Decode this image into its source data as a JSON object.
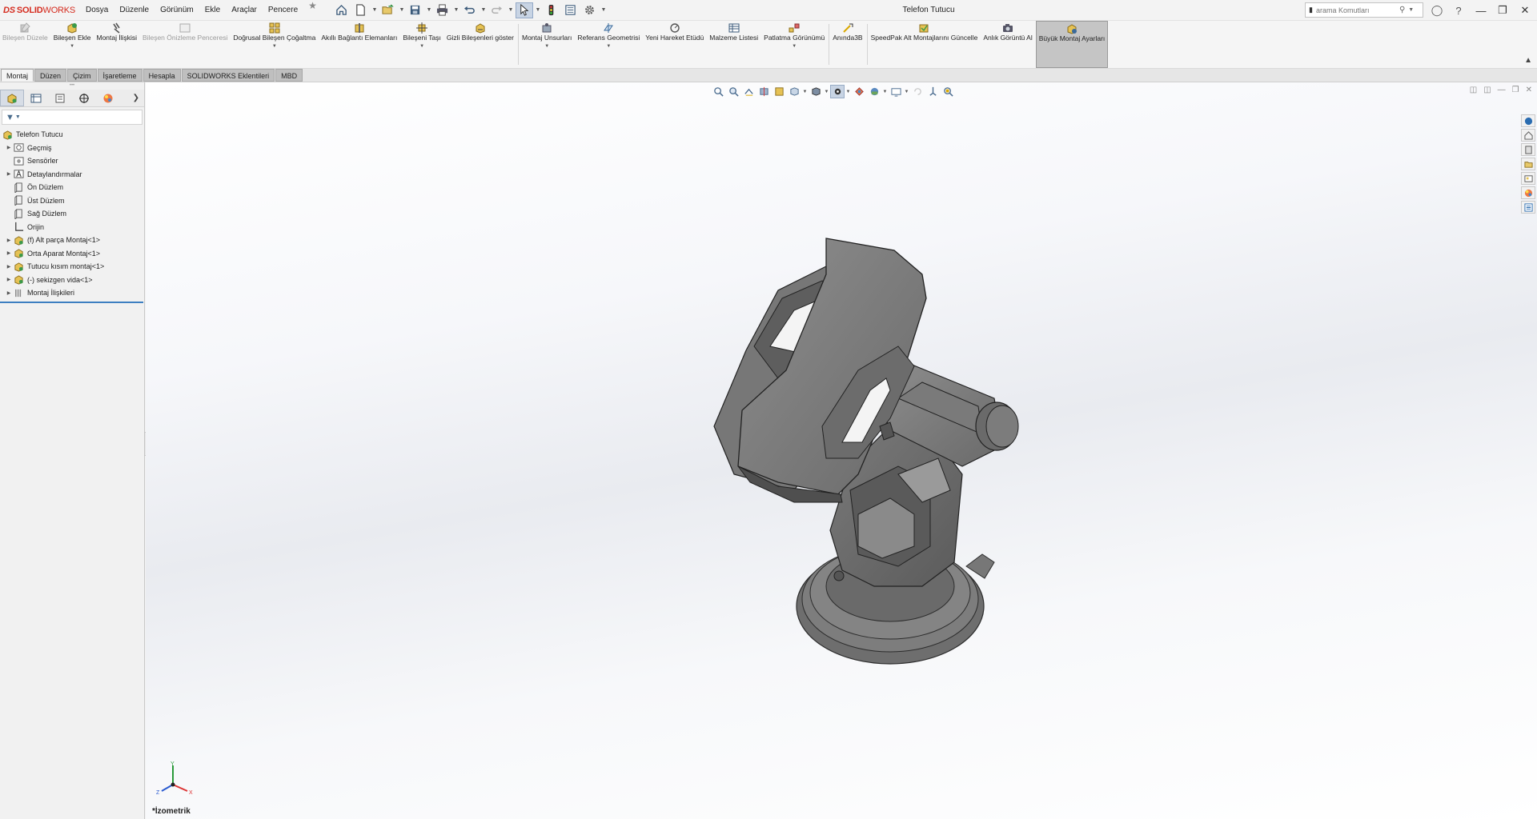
{
  "app": {
    "logo_prefix": "DS",
    "logo_solid": "SOLID",
    "logo_works": "WORKS",
    "document_title": "Telefon Tutucu"
  },
  "menu": [
    "Dosya",
    "Düzenle",
    "Görünüm",
    "Ekle",
    "Araçlar",
    "Pencere"
  ],
  "quick_access": [
    "home-icon",
    "new-document-icon",
    "open-icon",
    "save-icon",
    "print-icon",
    "undo-icon",
    "redo-icon",
    "select-arrow-icon",
    "traffic-light-icon",
    "file-properties-icon",
    "options-gear-icon"
  ],
  "search": {
    "placeholder": "arama Komutları"
  },
  "ribbon": [
    {
      "label": "Bileşen Düzele",
      "icon": "edit-component-icon",
      "disabled": true
    },
    {
      "label": "Bileşen Ekle",
      "icon": "insert-component-icon"
    },
    {
      "label": "Montaj İlişkisi",
      "icon": "mate-icon"
    },
    {
      "label": "Bileşen Önizleme Penceresi",
      "icon": "component-preview-icon",
      "disabled": true
    },
    {
      "label": "Doğrusal Bileşen Çoğaltma",
      "icon": "linear-pattern-icon"
    },
    {
      "label": "Akıllı Bağlantı Elemanları",
      "icon": "smart-fasteners-icon"
    },
    {
      "label": "Bileşeni Taşı",
      "icon": "move-component-icon"
    },
    {
      "label": "Gizli Bileşenleri göster",
      "icon": "show-hidden-icon"
    },
    {
      "label": "Montaj Unsurları",
      "icon": "assembly-features-icon"
    },
    {
      "label": "Referans Geometrisi",
      "icon": "reference-geometry-icon"
    },
    {
      "label": "Yeni Hareket Etüdü",
      "icon": "motion-study-icon"
    },
    {
      "label": "Malzeme Listesi",
      "icon": "bom-icon"
    },
    {
      "label": "Patlatma Görünümü",
      "icon": "exploded-view-icon"
    },
    {
      "label": "Anında3B",
      "icon": "instant3d-icon"
    },
    {
      "label": "SpeedPak Alt Montajlarını Güncelle",
      "icon": "speedpak-icon"
    },
    {
      "label": "Anlık Görüntü Al",
      "icon": "snapshot-icon"
    },
    {
      "label": "Büyük Montaj Ayarları",
      "icon": "large-assembly-icon",
      "active": true
    }
  ],
  "tabs": [
    "Montaj",
    "Düzen",
    "Çizim",
    "İşaretleme",
    "Hesapla",
    "SOLIDWORKS Eklentileri",
    "MBD"
  ],
  "active_tab": "Montaj",
  "feature_tree": {
    "root": "Telefon Tutucu",
    "items": [
      {
        "label": "Geçmiş",
        "icon": "history-icon",
        "expandable": true
      },
      {
        "label": "Sensörler",
        "icon": "sensor-icon",
        "expandable": false
      },
      {
        "label": "Detaylandırmalar",
        "icon": "annotations-icon",
        "expandable": true
      },
      {
        "label": "Ön Düzlem",
        "icon": "plane-icon",
        "expandable": false
      },
      {
        "label": "Üst Düzlem",
        "icon": "plane-icon",
        "expandable": false
      },
      {
        "label": "Sağ Düzlem",
        "icon": "plane-icon",
        "expandable": false
      },
      {
        "label": "Orijin",
        "icon": "origin-icon",
        "expandable": false
      },
      {
        "label": "(f) Alt parça Montaj<1>",
        "icon": "subassembly-icon",
        "expandable": true
      },
      {
        "label": "Orta Aparat Montaj<1>",
        "icon": "subassembly-icon",
        "expandable": true
      },
      {
        "label": "Tutucu kısım montaj<1>",
        "icon": "subassembly-icon",
        "expandable": true
      },
      {
        "label": "(-) sekizgen vida<1>",
        "icon": "subassembly-icon",
        "expandable": true
      },
      {
        "label": "Montaj İlişkileri",
        "icon": "mates-folder-icon",
        "expandable": true
      }
    ]
  },
  "viewport": {
    "view_name": "*İzometrik",
    "triad_axes": [
      "Y",
      "X",
      "Z"
    ]
  },
  "colors": {
    "accent": "#3d7fc1",
    "model_gray": "#6b6b6b",
    "logo_red": "#d52b1e"
  }
}
